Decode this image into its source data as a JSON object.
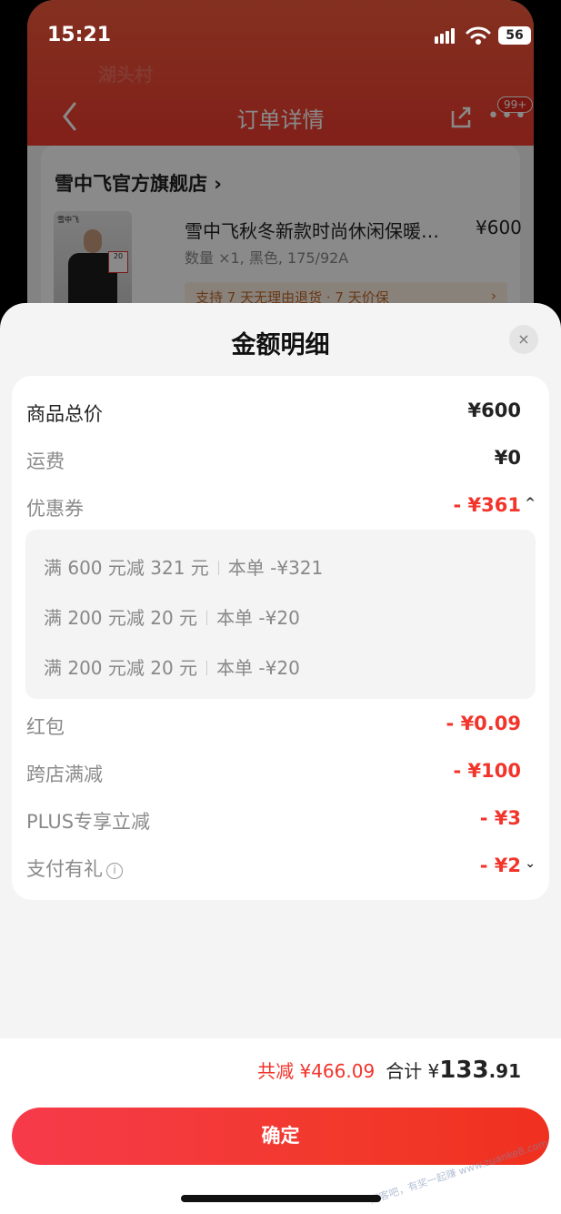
{
  "status_bar": {
    "time": "15:21",
    "battery": "56"
  },
  "background_page": {
    "ghost_text_1": "湖头村",
    "ghost_text_2": "",
    "title": "订单详情",
    "badge": "99+",
    "more": "•••",
    "store_name": "雪中飞官方旗舰店 ›",
    "thumb_brand": "雪中飞",
    "thumb_stamp": "20",
    "product_name": "雪中飞秋冬新款时尚休闲保暖…",
    "product_price": "¥600",
    "product_spec": "数量 ×1, 黑色, 175/92A",
    "support_text": "支持 7 天无理由退货 · 7 天价保",
    "support_arrow": "›"
  },
  "sheet": {
    "title": "金额明细",
    "close_icon": "×",
    "rows": {
      "goods_total": {
        "label": "商品总价",
        "value": "¥600"
      },
      "shipping": {
        "label": "运费",
        "value": "¥0"
      },
      "coupon": {
        "label": "优惠券",
        "value": "- ¥361",
        "chevron": "^"
      },
      "red_packet": {
        "label": "红包",
        "value": "- ¥0.09"
      },
      "cross_store": {
        "label": "跨店满减",
        "value": "- ¥100"
      },
      "plus": {
        "label": "PLUS专享立减",
        "value": "- ¥3"
      },
      "pay_gift": {
        "label": "支付有礼",
        "info": "i",
        "value": "- ¥2",
        "chevron": "⌄"
      }
    },
    "coupons": [
      {
        "rule": "满 600 元减 321 元",
        "scope": "本单",
        "amount": "-¥321"
      },
      {
        "rule": "满 200 元减 20 元",
        "scope": "本单",
        "amount": "-¥20"
      },
      {
        "rule": "满 200 元减 20 元",
        "scope": "本单",
        "amount": "-¥20"
      }
    ]
  },
  "footer": {
    "saved_label": "共减 ¥466.09",
    "total_label": "合计 ¥",
    "total_int": "133",
    "total_dec": ".91",
    "confirm": "确定",
    "watermark": "赚客吧，有奖一起赚 www.zuanke8.com"
  },
  "colors": {
    "accent_red": "#f2342b",
    "header_red": "#ee3b2e"
  }
}
